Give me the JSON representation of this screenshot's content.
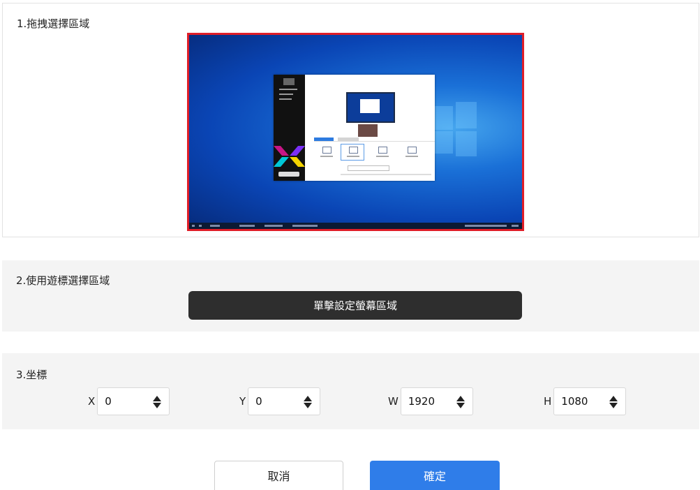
{
  "section_area": {
    "title": "1.拖拽選擇區域"
  },
  "section_cursor": {
    "title": "2.使用遊標選擇區域",
    "button_label": "單擊設定螢幕區域"
  },
  "section_coords": {
    "title": "3.坐標",
    "fields": [
      {
        "label": "X",
        "value": "0"
      },
      {
        "label": "Y",
        "value": "0"
      },
      {
        "label": "W",
        "value": "1920"
      },
      {
        "label": "H",
        "value": "1080"
      }
    ]
  },
  "footer": {
    "cancel_label": "取消",
    "ok_label": "確定"
  },
  "colors": {
    "selection_border": "#e01e28",
    "primary": "#2f7de9",
    "dark_button": "#2e2e2e"
  }
}
